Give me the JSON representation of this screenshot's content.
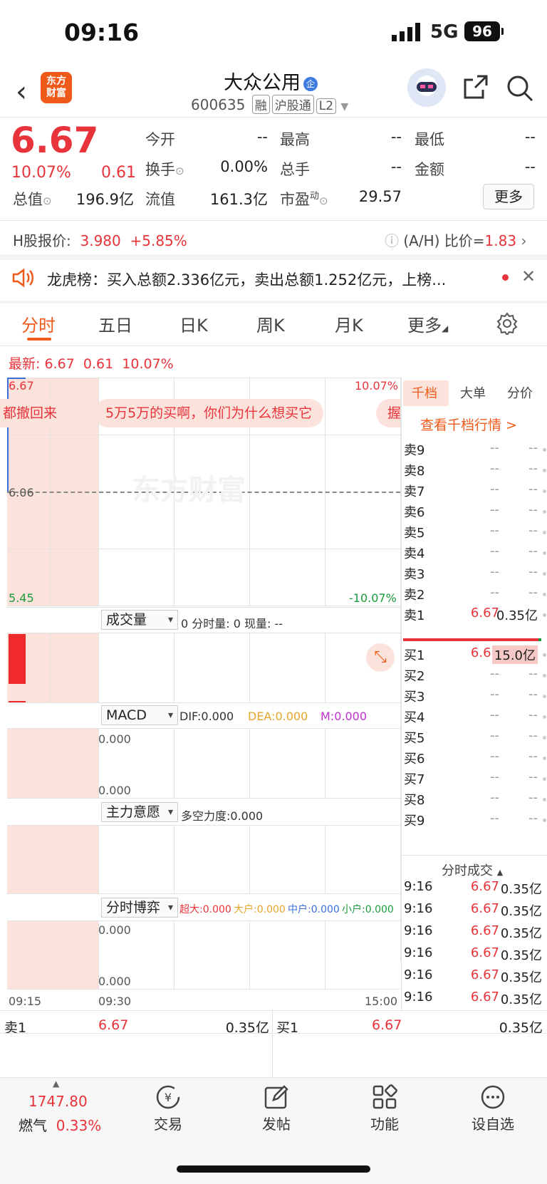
{
  "status": {
    "time": "09:16",
    "network": "5G",
    "battery": "96"
  },
  "header": {
    "logo_line1": "东方",
    "logo_line2": "财富",
    "title": "大众公用",
    "title_badge": "企",
    "code": "600635",
    "tags": [
      "融",
      "沪股通",
      "L2"
    ]
  },
  "quote": {
    "price": "6.67",
    "pct": "10.07%",
    "change": "0.61",
    "fields": [
      {
        "label": "今开",
        "value": "--"
      },
      {
        "label": "最高",
        "value": "--"
      },
      {
        "label": "最低",
        "value": "--"
      },
      {
        "label": "换手",
        "value": "0.00%"
      },
      {
        "label": "总手",
        "value": "--"
      },
      {
        "label": "金额",
        "value": "--"
      },
      {
        "label": "总值",
        "value": "196.9亿"
      },
      {
        "label": "流值",
        "value": "161.3亿"
      },
      {
        "label": "市盈",
        "sup": "动",
        "value": "29.57"
      }
    ],
    "more": "更多"
  },
  "hshare": {
    "label": "H股报价:",
    "price": "3.980",
    "pct": "+5.85%",
    "ratio_label": "(A/H) 比价=",
    "ratio": "1.83"
  },
  "notice": {
    "text": "龙虎榜：买入总额2.336亿元，卖出总额1.252亿元，上榜..."
  },
  "tabs": [
    "分时",
    "五日",
    "日K",
    "周K",
    "月K",
    "更多"
  ],
  "latest": {
    "label": "最新:",
    "price": "6.67",
    "change": "0.61",
    "pct": "10.07%"
  },
  "chart": {
    "top_price": "6.67",
    "top_pct": "10.07%",
    "mid_price": "6.06",
    "low_price": "5.45",
    "low_pct": "-10.07%",
    "danmu": [
      "都撤回来",
      "5万5万的买啊，你们为什么想买它",
      "握"
    ],
    "watermark": "东方财富",
    "time_start": "09:15",
    "time_mid": "09:30",
    "time_end": "15:00"
  },
  "volume": {
    "select": "成交量",
    "text": "0 分时量: 0 现量: --"
  },
  "macd": {
    "select": "MACD",
    "dif": "DIF:0.000",
    "dea": "DEA:0.000",
    "m": "M:0.000",
    "v1": "0.000",
    "v2": "0.000"
  },
  "zhuli": {
    "select": "主力意愿",
    "text": "多空力度:0.000"
  },
  "boyi": {
    "select": "分时博弈",
    "chaoda": "超大:0.000",
    "dahu": "大户:0.000",
    "zhonghu": "中户:0.000",
    "xiaohu": "小户:0.000",
    "v1": "0.000",
    "v2": "0.000"
  },
  "side": {
    "tabs": [
      "千档",
      "大单",
      "分价"
    ],
    "link": "查看千档行情 >",
    "sells": [
      {
        "n": "卖9",
        "p": "--",
        "v": "--"
      },
      {
        "n": "卖8",
        "p": "--",
        "v": "--"
      },
      {
        "n": "卖7",
        "p": "--",
        "v": "--"
      },
      {
        "n": "卖6",
        "p": "--",
        "v": "--"
      },
      {
        "n": "卖5",
        "p": "--",
        "v": "--"
      },
      {
        "n": "卖4",
        "p": "--",
        "v": "--"
      },
      {
        "n": "卖3",
        "p": "--",
        "v": "--"
      },
      {
        "n": "卖2",
        "p": "--",
        "v": "--"
      },
      {
        "n": "卖1",
        "p": "6.67",
        "v": "0.35亿"
      }
    ],
    "buys": [
      {
        "n": "买1",
        "p": "6.67",
        "v": "15.0亿"
      },
      {
        "n": "买2",
        "p": "--",
        "v": "--"
      },
      {
        "n": "买3",
        "p": "--",
        "v": "--"
      },
      {
        "n": "买4",
        "p": "--",
        "v": "--"
      },
      {
        "n": "买5",
        "p": "--",
        "v": "--"
      },
      {
        "n": "买6",
        "p": "--",
        "v": "--"
      },
      {
        "n": "买7",
        "p": "--",
        "v": "--"
      },
      {
        "n": "买8",
        "p": "--",
        "v": "--"
      },
      {
        "n": "买9",
        "p": "--",
        "v": "--"
      }
    ],
    "ticks_title": "分时成交",
    "ticks": [
      {
        "t": "9:16",
        "p": "6.67",
        "v": "0.35亿"
      },
      {
        "t": "9:16",
        "p": "6.67",
        "v": "0.35亿"
      },
      {
        "t": "9:16",
        "p": "6.67",
        "v": "0.35亿"
      },
      {
        "t": "9:16",
        "p": "6.67",
        "v": "0.35亿"
      },
      {
        "t": "9:16",
        "p": "6.67",
        "v": "0.35亿"
      },
      {
        "t": "9:16",
        "p": "6.67",
        "v": "0.35亿"
      }
    ]
  },
  "bottom_quote": {
    "sell_label": "卖1",
    "sell_price": "6.67",
    "sell_vol": "0.35亿",
    "buy_label": "买1",
    "buy_price": "6.67",
    "buy_vol": "0.35亿"
  },
  "nav": {
    "index_value": "1747.80",
    "index_name": "燃气",
    "index_pct": "0.33%",
    "items": [
      "交易",
      "发帖",
      "功能",
      "设自选"
    ]
  }
}
